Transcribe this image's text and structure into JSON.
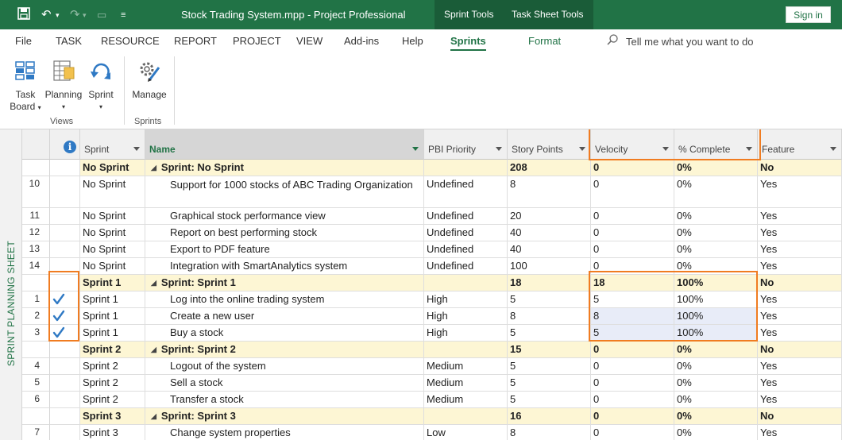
{
  "window": {
    "title": "Stock Trading System.mpp  -  Project Professional",
    "tool_tabs": [
      "Sprint Tools",
      "Task Sheet Tools"
    ],
    "sign_in": "Sign in"
  },
  "menu": {
    "items": [
      "File",
      "TASK",
      "RESOURCE",
      "REPORT",
      "PROJECT",
      "VIEW",
      "Add-ins",
      "Help",
      "Sprints",
      "Format"
    ],
    "active": "Sprints",
    "tell_me": "Tell me what you want to do"
  },
  "ribbon": {
    "buttons": {
      "task_board": [
        "Task",
        "Board"
      ],
      "planning": "Planning",
      "sprint": "Sprint",
      "manage": "Manage"
    },
    "groups": {
      "views": "Views",
      "sprints": "Sprints"
    }
  },
  "side_label": "SPRINT PLANNING SHEET",
  "columns": {
    "info": "i",
    "sprint": "Sprint",
    "name": "Name",
    "pbi_priority": "PBI Priority",
    "story_points": "Story Points",
    "velocity": "Velocity",
    "pct_complete": "% Complete",
    "feature": "Feature"
  },
  "rows": [
    {
      "id": "",
      "summary": true,
      "check": false,
      "sprint": "No Sprint",
      "name": "Sprint: No Sprint",
      "priority": "",
      "points": "208",
      "velocity": "0",
      "pct": "0%",
      "feature": "No"
    },
    {
      "id": "10",
      "summary": false,
      "check": false,
      "sprint": "No Sprint",
      "name": "Support for 1000 stocks of ABC Trading Organization",
      "priority": "Undefined",
      "points": "8",
      "velocity": "0",
      "pct": "0%",
      "feature": "Yes"
    },
    {
      "id": "11",
      "summary": false,
      "check": false,
      "sprint": "No Sprint",
      "name": "Graphical stock performance view",
      "priority": "Undefined",
      "points": "20",
      "velocity": "0",
      "pct": "0%",
      "feature": "Yes"
    },
    {
      "id": "12",
      "summary": false,
      "check": false,
      "sprint": "No Sprint",
      "name": "Report on best performing stock",
      "priority": "Undefined",
      "points": "40",
      "velocity": "0",
      "pct": "0%",
      "feature": "Yes"
    },
    {
      "id": "13",
      "summary": false,
      "check": false,
      "sprint": "No Sprint",
      "name": "Export to PDF feature",
      "priority": "Undefined",
      "points": "40",
      "velocity": "0",
      "pct": "0%",
      "feature": "Yes"
    },
    {
      "id": "14",
      "summary": false,
      "check": false,
      "sprint": "No Sprint",
      "name": "Integration with SmartAnalytics system",
      "priority": "Undefined",
      "points": "100",
      "velocity": "0",
      "pct": "0%",
      "feature": "Yes"
    },
    {
      "id": "",
      "summary": true,
      "check": false,
      "sprint": "Sprint 1",
      "name": "Sprint: Sprint 1",
      "priority": "",
      "points": "18",
      "velocity": "18",
      "pct": "100%",
      "feature": "No"
    },
    {
      "id": "1",
      "summary": false,
      "check": true,
      "sprint": "Sprint 1",
      "name": "Log into the online trading system",
      "priority": "High",
      "points": "5",
      "velocity": "5",
      "pct": "100%",
      "feature": "Yes"
    },
    {
      "id": "2",
      "summary": false,
      "check": true,
      "sprint": "Sprint 1",
      "name": "Create a new user",
      "priority": "High",
      "points": "8",
      "velocity": "8",
      "pct": "100%",
      "feature": "Yes"
    },
    {
      "id": "3",
      "summary": false,
      "check": true,
      "sprint": "Sprint 1",
      "name": "Buy a stock",
      "priority": "High",
      "points": "5",
      "velocity": "5",
      "pct": "100%",
      "feature": "Yes"
    },
    {
      "id": "",
      "summary": true,
      "check": false,
      "sprint": "Sprint 2",
      "name": "Sprint: Sprint 2",
      "priority": "",
      "points": "15",
      "velocity": "0",
      "pct": "0%",
      "feature": "No"
    },
    {
      "id": "4",
      "summary": false,
      "check": false,
      "sprint": "Sprint 2",
      "name": "Logout of the system",
      "priority": "Medium",
      "points": "5",
      "velocity": "0",
      "pct": "0%",
      "feature": "Yes"
    },
    {
      "id": "5",
      "summary": false,
      "check": false,
      "sprint": "Sprint 2",
      "name": "Sell a stock",
      "priority": "Medium",
      "points": "5",
      "velocity": "0",
      "pct": "0%",
      "feature": "Yes"
    },
    {
      "id": "6",
      "summary": false,
      "check": false,
      "sprint": "Sprint 2",
      "name": "Transfer a stock",
      "priority": "Medium",
      "points": "5",
      "velocity": "0",
      "pct": "0%",
      "feature": "Yes"
    },
    {
      "id": "",
      "summary": true,
      "check": false,
      "sprint": "Sprint 3",
      "name": "Sprint: Sprint 3",
      "priority": "",
      "points": "16",
      "velocity": "0",
      "pct": "0%",
      "feature": "No"
    },
    {
      "id": "7",
      "summary": false,
      "check": false,
      "sprint": "Sprint 3",
      "name": "Change system properties",
      "priority": "Low",
      "points": "8",
      "velocity": "0",
      "pct": "0%",
      "feature": "Yes"
    }
  ],
  "colors": {
    "accent": "#217346",
    "summary_row": "#fdf6d4",
    "highlight_box": "#f07c21",
    "check": "#2f79c4",
    "selected_cell": "#e8ecf8"
  }
}
